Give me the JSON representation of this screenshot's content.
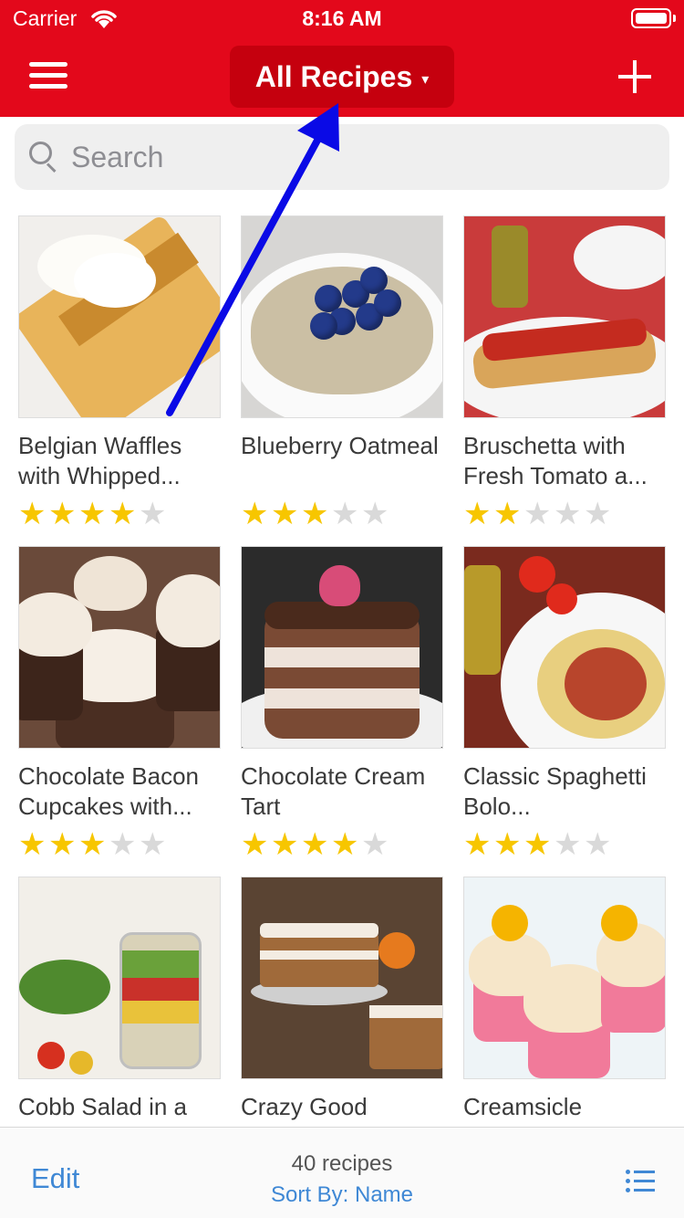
{
  "status": {
    "carrier": "Carrier",
    "time": "8:16 AM"
  },
  "nav": {
    "title": "All Recipes",
    "caret": "▾",
    "menu_icon": "hamburger-menu-icon",
    "add_icon": "plus-icon"
  },
  "search": {
    "placeholder": "Search",
    "value": ""
  },
  "recipes": [
    {
      "title": "Belgian Waffles with Whipped...",
      "rating": 4
    },
    {
      "title": "Blueberry Oatmeal",
      "rating": 3
    },
    {
      "title": "Bruschetta with Fresh Tomato a...",
      "rating": 2
    },
    {
      "title": "Chocolate Bacon Cupcakes with...",
      "rating": 3
    },
    {
      "title": "Chocolate Cream Tart",
      "rating": 4
    },
    {
      "title": "Classic Spaghetti Bolo...",
      "rating": 3
    },
    {
      "title": "Cobb Salad in a",
      "rating": null
    },
    {
      "title": "Crazy Good",
      "rating": null
    },
    {
      "title": "Creamsicle",
      "rating": null
    }
  ],
  "footer": {
    "edit_label": "Edit",
    "count_label": "40 recipes",
    "sort_label": "Sort By: Name",
    "list_icon": "list-view-icon"
  },
  "colors": {
    "nav_red": "#e3081b",
    "title_button_red": "#c5000e",
    "star_gold": "#f7c600",
    "link_blue": "#3f88d5",
    "annotation_arrow": "#0a0ae6"
  }
}
